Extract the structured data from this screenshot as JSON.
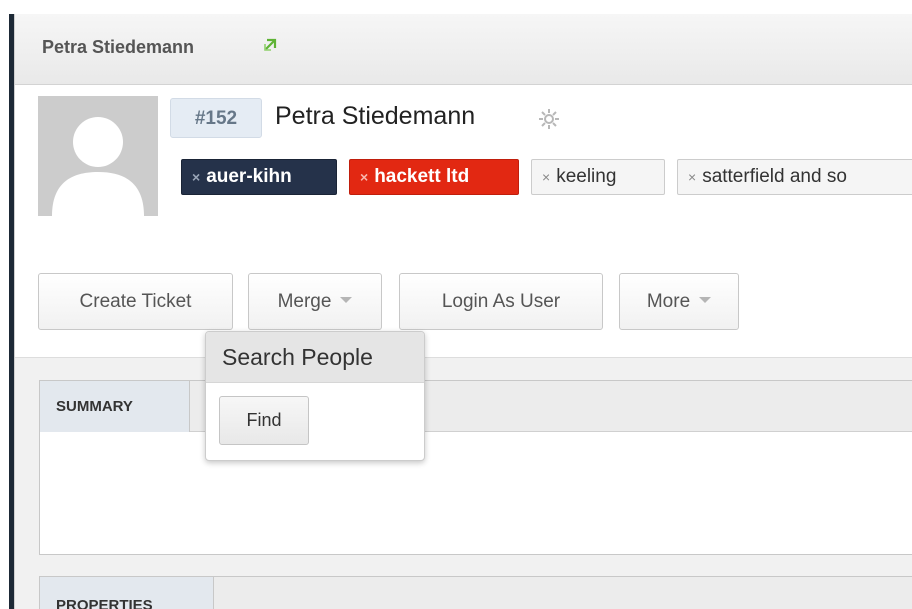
{
  "header": {
    "title": "Petra Stiedemann",
    "link_icon": "external-link-icon",
    "accent_color": "#5fb336"
  },
  "profile": {
    "avatar_icon": "avatar-placeholder",
    "id_badge": "#152",
    "name": "Petra Stiedemann",
    "settings_icon": "gear-icon"
  },
  "tags": [
    {
      "label": "auer-kihn",
      "remove_symbol": "×",
      "color": "#25324a"
    },
    {
      "label": "hackett ltd",
      "remove_symbol": "×",
      "color": "#e22812"
    },
    {
      "label": "keeling",
      "remove_symbol": "×",
      "color": "#f5f5f5"
    },
    {
      "label": "satterfield and so",
      "remove_symbol": "×",
      "color": "#f5f5f5"
    }
  ],
  "actions": {
    "create_ticket": "Create Ticket",
    "merge": "Merge",
    "login_as_user": "Login As User",
    "more": "More"
  },
  "merge_popover": {
    "title": "Search People",
    "find_button": "Find"
  },
  "sections": {
    "summary": "SUMMARY",
    "properties": "PROPERTIES"
  }
}
